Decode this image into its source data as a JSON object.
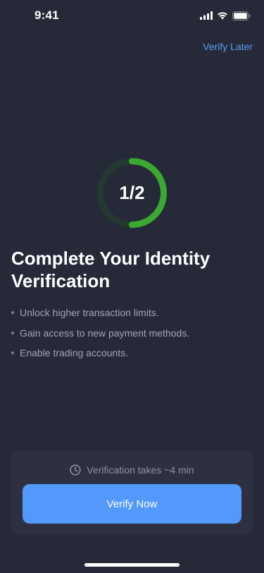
{
  "status_bar": {
    "time": "9:41",
    "icons": [
      "cellular-signal-icon",
      "wifi-icon",
      "battery-icon"
    ]
  },
  "header": {
    "verify_later_label": "Verify Later"
  },
  "progress": {
    "label": "1/2",
    "completed": 1,
    "total": 2,
    "track_color": "#24392f",
    "fill_color": "#3ba831"
  },
  "main": {
    "title": "Complete Your Identity Verification",
    "benefits": [
      "Unlock higher transaction limits.",
      "Gain access to new payment methods.",
      "Enable trading accounts."
    ]
  },
  "footer": {
    "time_note": "Verification takes ~4 min",
    "time_icon": "clock-icon",
    "verify_now_label": "Verify Now",
    "accent_color": "#5299fb"
  },
  "colors": {
    "background": "#262938",
    "card": "#2d3040",
    "link": "#5a9bf5"
  }
}
